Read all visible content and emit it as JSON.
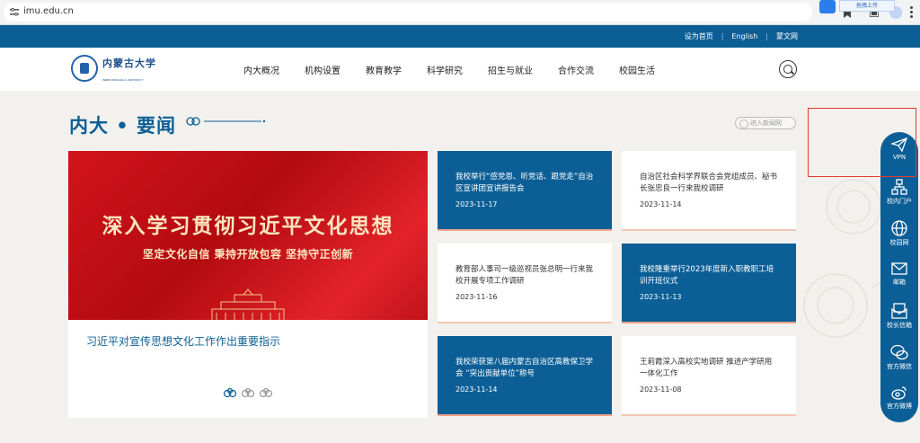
{
  "browser": {
    "url": "imu.edu.cn",
    "popup_label": "拖拽上传"
  },
  "util_bar": {
    "links": [
      "设为首页",
      "English",
      "蒙文网"
    ]
  },
  "header": {
    "logo_text": "内蒙古大学",
    "logo_sub": "INNER MONGOLIA UNIVERSITY",
    "nav": [
      "内大概况",
      "机构设置",
      "教育教学",
      "科学研究",
      "招生与就业",
      "合作交流",
      "校园生活"
    ]
  },
  "section": {
    "title": "内大 • 要闻",
    "more_label": "进入新闻网"
  },
  "feature": {
    "banner_title": "深入学习贯彻习近平文化思想",
    "banner_sub": "坚定文化自信  秉持开放包容  坚持守正创新",
    "caption": "习近平对宣传思想文化工作作出重要指示"
  },
  "news": [
    {
      "title": "我校举行“感党恩、听党话、跟党走”自治区宣讲团宣讲报告会",
      "date": "2023-11-17",
      "style": "blue"
    },
    {
      "title": "自治区社会科学界联合会党组成员、秘书长张忠良一行来我校调研",
      "date": "2023-11-14",
      "style": "white"
    },
    {
      "title": "教育部人事司一级巡视员张总明一行来我校开展专项工作调研",
      "date": "2023-11-16",
      "style": "white"
    },
    {
      "title": "我校隆重举行2023年度新入职教职工培训开班仪式",
      "date": "2023-11-13",
      "style": "blue"
    },
    {
      "title": "我校荣获第八届内蒙古自治区高教保卫学会 “突出贡献单位”称号",
      "date": "2023-11-14",
      "style": "blue"
    },
    {
      "title": "王莉霞深入高校实地调研 推进产学研用一体化工作",
      "date": "2023-11-08",
      "style": "white"
    }
  ],
  "sidebar": {
    "items": [
      "VPN",
      "校内门户",
      "校园网",
      "邮箱",
      "校长信箱",
      "官方微信",
      "官方微博"
    ]
  },
  "colors": {
    "primary": "#0c5f96",
    "banner_red": "#d2131b",
    "highlight": "#e23b2e"
  }
}
